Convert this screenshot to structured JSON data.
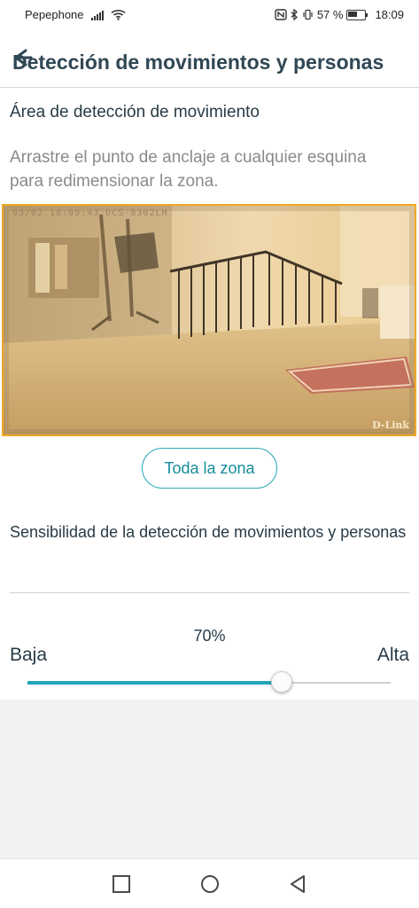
{
  "status_bar": {
    "carrier": "Pepephone",
    "battery": "57 %",
    "time": "18:09",
    "icons": [
      "signal-icon",
      "wifi-icon",
      "nfc-icon",
      "bluetooth-icon",
      "vibrate-icon",
      "battery-icon"
    ]
  },
  "header": {
    "title": "Detección de movimientos y personas",
    "back_icon": "back-arrow-icon"
  },
  "detection_area": {
    "title": "Área de detección de movimiento",
    "instruction": "Arrastre el punto de anclaje a cualquier esquina para redimensionar la zona.",
    "camera_timestamp": "03/02 18:09:43 DCS-8302LH",
    "camera_brand": "D-Link",
    "zone_color": "#f0a825"
  },
  "buttons": {
    "all_zone": "Toda la zona"
  },
  "sensitivity": {
    "title": "Sensibilidad de la detección de movimientos y personas",
    "value_label": "70%",
    "value": 0.7,
    "low_label": "Baja",
    "high_label": "Alta",
    "accent_color": "#23a6ba"
  },
  "navigation": {
    "icons": [
      "recent-apps-icon",
      "home-icon",
      "back-icon"
    ]
  }
}
